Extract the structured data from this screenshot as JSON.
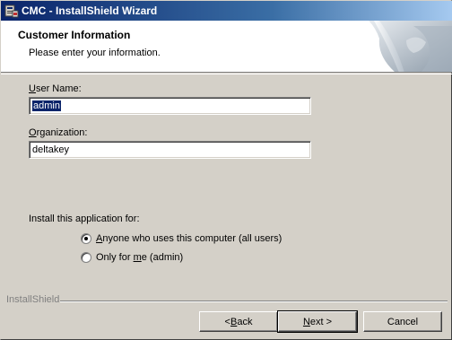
{
  "window": {
    "title": "CMC - InstallShield Wizard"
  },
  "banner": {
    "title": "Customer Information",
    "subtitle": "Please enter your information."
  },
  "form": {
    "user_name_label_u": "U",
    "user_name_label_rest": "ser Name:",
    "user_name_value": "admin",
    "organization_label_u": "O",
    "organization_label_rest": "rganization:",
    "organization_value": "deltakey",
    "install_for_label": "Install this application for:",
    "options": [
      {
        "prefix": "",
        "underlined": "A",
        "suffix": "nyone who uses this computer (all users)",
        "selected": true
      },
      {
        "prefix": "Only for ",
        "underlined": "m",
        "suffix": "e (admin)",
        "selected": false
      }
    ]
  },
  "footer": {
    "brand": "InstallShield",
    "back_prefix": "< ",
    "back_underlined": "B",
    "back_suffix": "ack",
    "next_underlined": "N",
    "next_suffix": "ext >",
    "cancel_label": "Cancel"
  }
}
